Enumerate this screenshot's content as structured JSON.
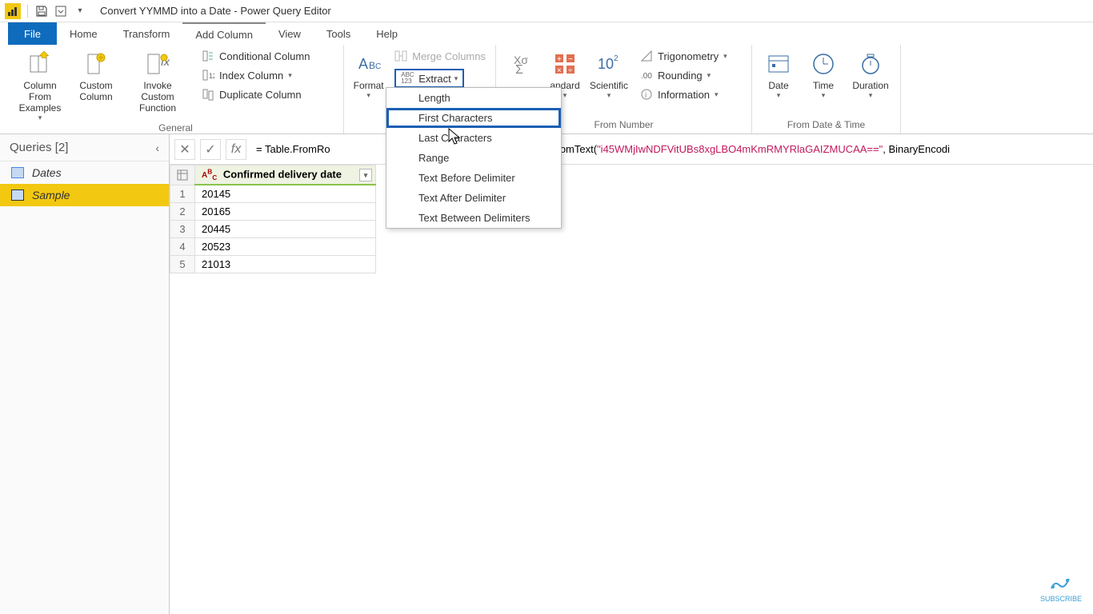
{
  "title": "Convert YYMMD into a Date - Power Query Editor",
  "tabs": {
    "file": "File",
    "home": "Home",
    "transform": "Transform",
    "add_column": "Add Column",
    "view": "View",
    "tools": "Tools",
    "help": "Help"
  },
  "ribbon": {
    "general": {
      "label": "General",
      "column_from_examples": "Column From Examples",
      "custom_column": "Custom Column",
      "invoke_custom_function": "Invoke Custom Function",
      "conditional_column": "Conditional Column",
      "index_column": "Index Column",
      "duplicate_column": "Duplicate Column"
    },
    "from_text": {
      "format": "Format",
      "merge_columns": "Merge Columns",
      "extract": "Extract"
    },
    "from_number": {
      "label": "From Number",
      "standard": "andard",
      "scientific": "Scientific",
      "trigonometry": "Trigonometry",
      "rounding": "Rounding",
      "information": "Information"
    },
    "from_datetime": {
      "label": "From Date & Time",
      "date": "Date",
      "time": "Time",
      "duration": "Duration"
    }
  },
  "extract_menu": {
    "length": "Length",
    "first_characters": "First Characters",
    "last_characters": "Last Characters",
    "range": "Range",
    "text_before_delimiter": "Text Before Delimiter",
    "text_after_delimiter": "Text After Delimiter",
    "text_between_delimiters": "Text Between Delimiters"
  },
  "queries": {
    "header": "Queries [2]",
    "items": [
      "Dates",
      "Sample"
    ]
  },
  "formula": {
    "prefix": "= Table.FromRo",
    "mid": "mpress(Binary.FromText(",
    "string": "\"i45WMjIwNDFVitUBs8xgLBO4mKmRMYRlaGAIZMUCAA==\"",
    "suffix": ", BinaryEncodi"
  },
  "grid": {
    "column_header": "Confirmed delivery date",
    "rows": [
      "20145",
      "20165",
      "20445",
      "20523",
      "21013"
    ]
  },
  "subscribe": "SUBSCRIBE"
}
